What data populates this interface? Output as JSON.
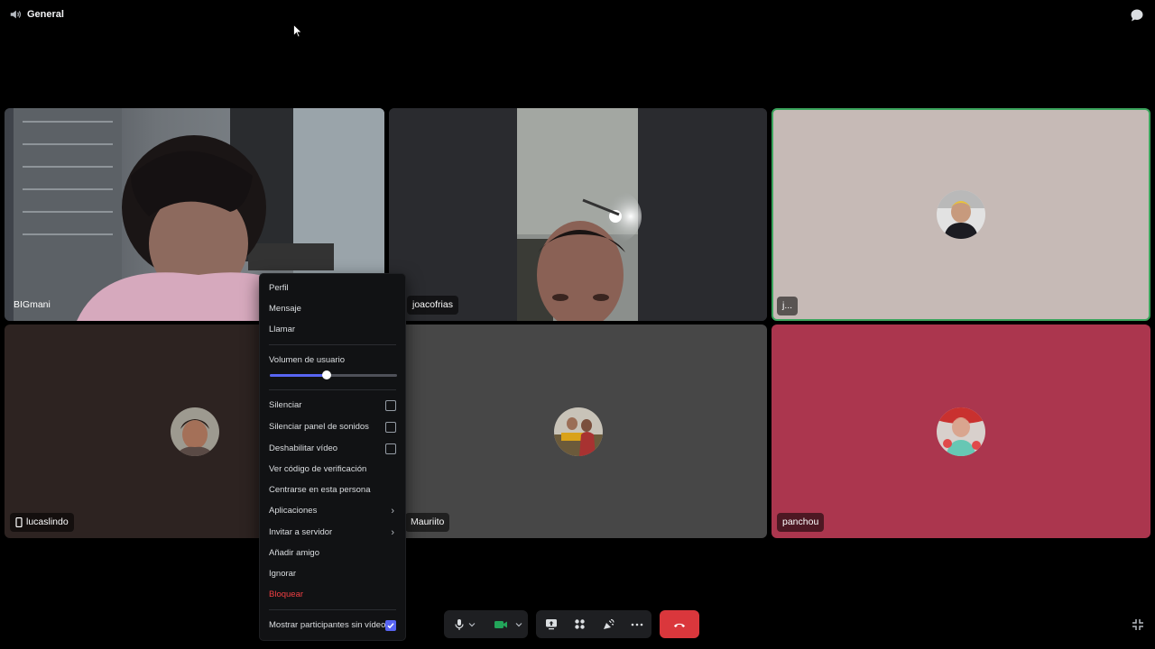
{
  "channel": {
    "name": "General",
    "icon": "speaker-icon"
  },
  "participants": [
    {
      "name": "BIGmani",
      "mode": "video"
    },
    {
      "name": "joacofrias",
      "mode": "video"
    },
    {
      "name": "j...",
      "mode": "avatar",
      "speaking": true
    },
    {
      "name": "lucaslindo",
      "mode": "avatar",
      "device_icon": "mobile-icon"
    },
    {
      "name": "Mauriito",
      "mode": "avatar"
    },
    {
      "name": "panchou",
      "mode": "avatar"
    }
  ],
  "context_menu": {
    "profile": "Perfil",
    "message": "Mensaje",
    "call": "Llamar",
    "user_volume_label": "Volumen de usuario",
    "user_volume_percent": 45,
    "mute": {
      "label": "Silenciar",
      "checked": false
    },
    "mute_soundboard": {
      "label": "Silenciar panel de sonidos",
      "checked": false
    },
    "disable_video": {
      "label": "Deshabilitar vídeo",
      "checked": false
    },
    "verification_code": "Ver código de verificación",
    "focus_person": "Centrarse en esta persona",
    "apps": "Aplicaciones",
    "invite_server": "Invitar a servidor",
    "add_friend": "Añadir amigo",
    "ignore": "Ignorar",
    "block": "Bloquear",
    "show_no_video": {
      "label": "Mostrar participantes sin vídeo",
      "checked": true
    }
  },
  "controls": {
    "icons": [
      "microphone-icon",
      "chevron-down-icon",
      "camera-icon",
      "chevron-down-icon",
      "screen-share-icon",
      "activities-icon",
      "soundboard-icon",
      "more-icon",
      "disconnect-icon",
      "fullscreen-exit-icon"
    ],
    "camera_on": true
  },
  "colors": {
    "accent": "#5865f2",
    "danger": "#da373c",
    "speaking": "#3ba55d",
    "camera_on": "#23a55a"
  }
}
